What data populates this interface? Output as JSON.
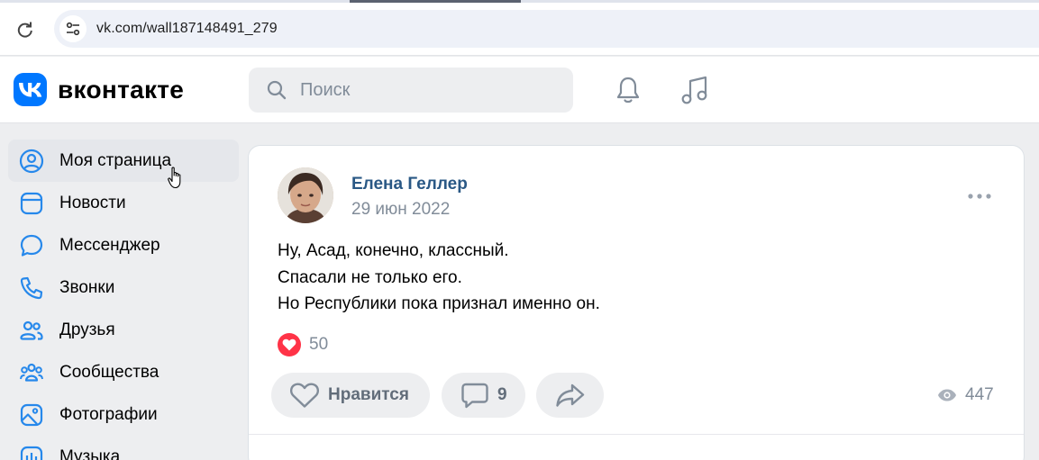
{
  "browser": {
    "url": "vk.com/wall187148491_279"
  },
  "header": {
    "logo_text": "вконтакте",
    "search_placeholder": "Поиск",
    "brand_color": "#0077ff"
  },
  "sidebar": {
    "items": [
      {
        "label": "Моя страница",
        "icon": "user-circle-icon",
        "active": true
      },
      {
        "label": "Новости",
        "icon": "news-icon"
      },
      {
        "label": "Мессенджер",
        "icon": "chat-bubble-icon"
      },
      {
        "label": "Звонки",
        "icon": "phone-icon"
      },
      {
        "label": "Друзья",
        "icon": "friends-icon"
      },
      {
        "label": "Сообщества",
        "icon": "communities-icon"
      },
      {
        "label": "Фотографии",
        "icon": "photo-icon"
      },
      {
        "label": "Музыка",
        "icon": "music-icon"
      }
    ]
  },
  "post": {
    "author": "Елена Геллер",
    "date": "29 июн 2022",
    "lines": [
      "Ну, Асад, конечно, классный.",
      "Спасали не только его.",
      "Но Республики пока признал именно он."
    ],
    "reaction_count": "50",
    "like_label": "Нравится",
    "comment_count": "9",
    "views": "447"
  }
}
